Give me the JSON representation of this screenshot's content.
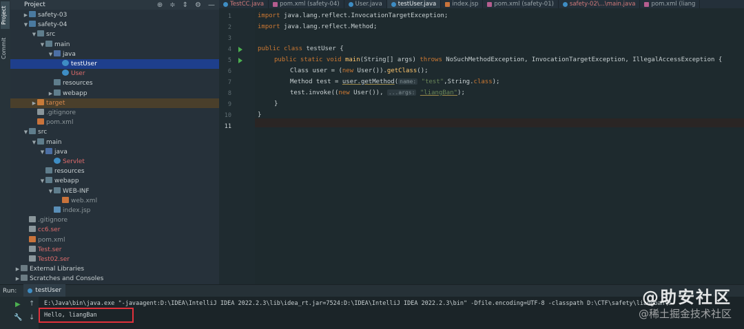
{
  "tool_strip": {
    "project_label": "Project",
    "commit_label": "Commit"
  },
  "project_panel": {
    "title": "Project",
    "tree": [
      {
        "label": "safety-03",
        "depth": 1,
        "arrow": "▶",
        "icon": "module",
        "style": ""
      },
      {
        "label": "safety-04",
        "depth": 1,
        "arrow": "▼",
        "icon": "module",
        "style": ""
      },
      {
        "label": "src",
        "depth": 2,
        "arrow": "▼",
        "icon": "folder",
        "style": ""
      },
      {
        "label": "main",
        "depth": 3,
        "arrow": "▼",
        "icon": "folder",
        "style": ""
      },
      {
        "label": "java",
        "depth": 4,
        "arrow": "▼",
        "icon": "src",
        "style": ""
      },
      {
        "label": "testUser",
        "depth": 5,
        "arrow": "",
        "icon": "java",
        "style": "selected"
      },
      {
        "label": "User",
        "depth": 5,
        "arrow": "",
        "icon": "java",
        "style": "red"
      },
      {
        "label": "resources",
        "depth": 4,
        "arrow": "",
        "icon": "folder",
        "style": ""
      },
      {
        "label": "webapp",
        "depth": 4,
        "arrow": "▶",
        "icon": "folder",
        "style": ""
      },
      {
        "label": "target",
        "depth": 2,
        "arrow": "▶",
        "icon": "target",
        "style": "highlight"
      },
      {
        "label": ".gitignore",
        "depth": 2,
        "arrow": "",
        "icon": "file",
        "style": "gray"
      },
      {
        "label": "pom.xml",
        "depth": 2,
        "arrow": "",
        "icon": "xml",
        "style": "gray"
      },
      {
        "label": "src",
        "depth": 1,
        "arrow": "▼",
        "icon": "folder",
        "style": ""
      },
      {
        "label": "main",
        "depth": 2,
        "arrow": "▼",
        "icon": "folder",
        "style": ""
      },
      {
        "label": "java",
        "depth": 3,
        "arrow": "▼",
        "icon": "src",
        "style": ""
      },
      {
        "label": "Servlet",
        "depth": 4,
        "arrow": "",
        "icon": "java",
        "style": "red"
      },
      {
        "label": "resources",
        "depth": 3,
        "arrow": "",
        "icon": "folder",
        "style": ""
      },
      {
        "label": "webapp",
        "depth": 3,
        "arrow": "▼",
        "icon": "folder",
        "style": ""
      },
      {
        "label": "WEB-INF",
        "depth": 4,
        "arrow": "▼",
        "icon": "folder",
        "style": ""
      },
      {
        "label": "web.xml",
        "depth": 5,
        "arrow": "",
        "icon": "xml",
        "style": "gray"
      },
      {
        "label": "index.jsp",
        "depth": 4,
        "arrow": "",
        "icon": "jsp",
        "style": "gray"
      },
      {
        "label": ".gitignore",
        "depth": 1,
        "arrow": "",
        "icon": "file",
        "style": "gray"
      },
      {
        "label": "cc6.ser",
        "depth": 1,
        "arrow": "",
        "icon": "file",
        "style": "red"
      },
      {
        "label": "pom.xml",
        "depth": 1,
        "arrow": "",
        "icon": "xml",
        "style": "gray"
      },
      {
        "label": "Test.ser",
        "depth": 1,
        "arrow": "",
        "icon": "file",
        "style": "red"
      },
      {
        "label": "Test02.ser",
        "depth": 1,
        "arrow": "",
        "icon": "file",
        "style": "red"
      },
      {
        "label": "External Libraries",
        "depth": 0,
        "arrow": "▶",
        "icon": "lib",
        "style": ""
      },
      {
        "label": "Scratches and Consoles",
        "depth": 0,
        "arrow": "▶",
        "icon": "lib",
        "style": ""
      }
    ]
  },
  "editor": {
    "tabs": [
      {
        "label": "TestCC.java",
        "icon": "java",
        "state": "modified"
      },
      {
        "label": "pom.xml (safety-04)",
        "icon": "m",
        "state": ""
      },
      {
        "label": "User.java",
        "icon": "java",
        "state": ""
      },
      {
        "label": "testUser.java",
        "icon": "java",
        "state": "active"
      },
      {
        "label": "index.jsp",
        "icon": "x",
        "state": ""
      },
      {
        "label": "pom.xml (safety-01)",
        "icon": "m",
        "state": ""
      },
      {
        "label": "safety-02\\...\\main.java",
        "icon": "java",
        "state": "modified"
      },
      {
        "label": "pom.xml (liang",
        "icon": "m",
        "state": ""
      }
    ],
    "line_numbers": [
      "1",
      "2",
      "3",
      "4",
      "5",
      "6",
      "7",
      "8",
      "9",
      "10",
      "11"
    ],
    "code": {
      "l1_kw": "import",
      "l1_rest": " java.lang.reflect.InvocationTargetException;",
      "l2_kw": "import",
      "l2_rest": " java.lang.reflect.Method;",
      "l4_kw1": "public",
      "l4_kw2": "class",
      "l4_rest": " testUser {",
      "l5_kw": "public static void",
      "l5_fn": "main",
      "l5_mid": "(String[] args) ",
      "l5_throws": "throws",
      "l5_rest": " NoSuchMethodException, InvocationTargetException, IllegalAccessException {",
      "l6_a": "Class",
      "l6_b": " user = (",
      "l6_new": "new",
      "l6_c": " User()).",
      "l6_fn": "getClass",
      "l6_d": "();",
      "l7_a": "Method test = ",
      "l7_u": "user.getMethod",
      "l7_b": "(",
      "l7_hint": "name:",
      "l7_str": "\"test\"",
      "l7_c": ",String.",
      "l7_cls": "class",
      "l7_d": ");",
      "l8_a": "test.invoke((",
      "l8_new": "new",
      "l8_b": " User()), ",
      "l8_hint": "...args:",
      "l8_str": "\"liangBan\"",
      "l8_c": ");",
      "l9": "}",
      "l10": "}"
    }
  },
  "run_panel": {
    "label": "Run:",
    "tab": "testUser",
    "command": "E:\\Java\\bin\\java.exe \"-javaagent:D:\\IDEA\\IntelliJ IDEA 2022.2.3\\lib\\idea_rt.jar=7524:D:\\IDEA\\IntelliJ IDEA 2022.2.3\\bin\" -Dfile.encoding=UTF-8 -classpath D:\\CTF\\safety\\liangban\\s",
    "output": "Hello, liangBan"
  },
  "watermark": {
    "main": "@助安社区",
    "sub": "@稀土掘金技术社区"
  },
  "colors": {
    "selection": "#1e3f8c",
    "output_box": "#e2313b",
    "keyword": "#cc7832",
    "string": "#6a8759"
  }
}
